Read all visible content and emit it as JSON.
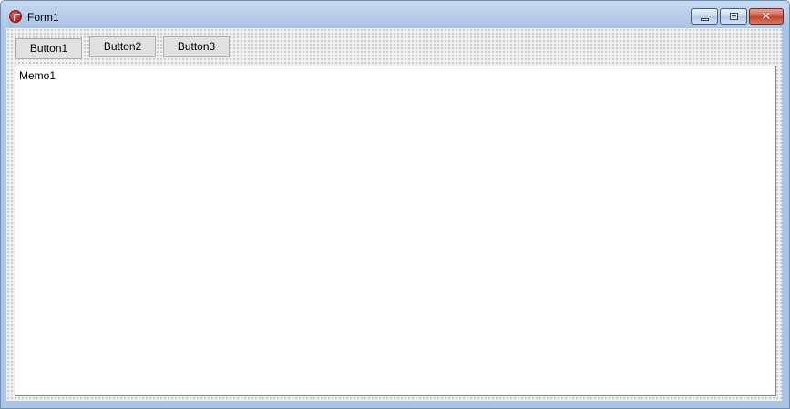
{
  "window": {
    "title": "Form1",
    "icon": "delphi-app-icon",
    "caption_buttons": {
      "minimize": "minimize-icon",
      "restore": "restore-icon",
      "close": "close-icon",
      "close_glyph": "✕"
    }
  },
  "toolbar": {
    "buttons": [
      {
        "label": "Button1"
      },
      {
        "label": "Button2"
      },
      {
        "label": "Button3"
      }
    ]
  },
  "memo": {
    "text": "Memo1"
  },
  "colors": {
    "titlebar": "#b9cfe9",
    "form_background": "#f0f0f0",
    "close_button": "#c2412b",
    "memo_background": "#ffffff"
  }
}
